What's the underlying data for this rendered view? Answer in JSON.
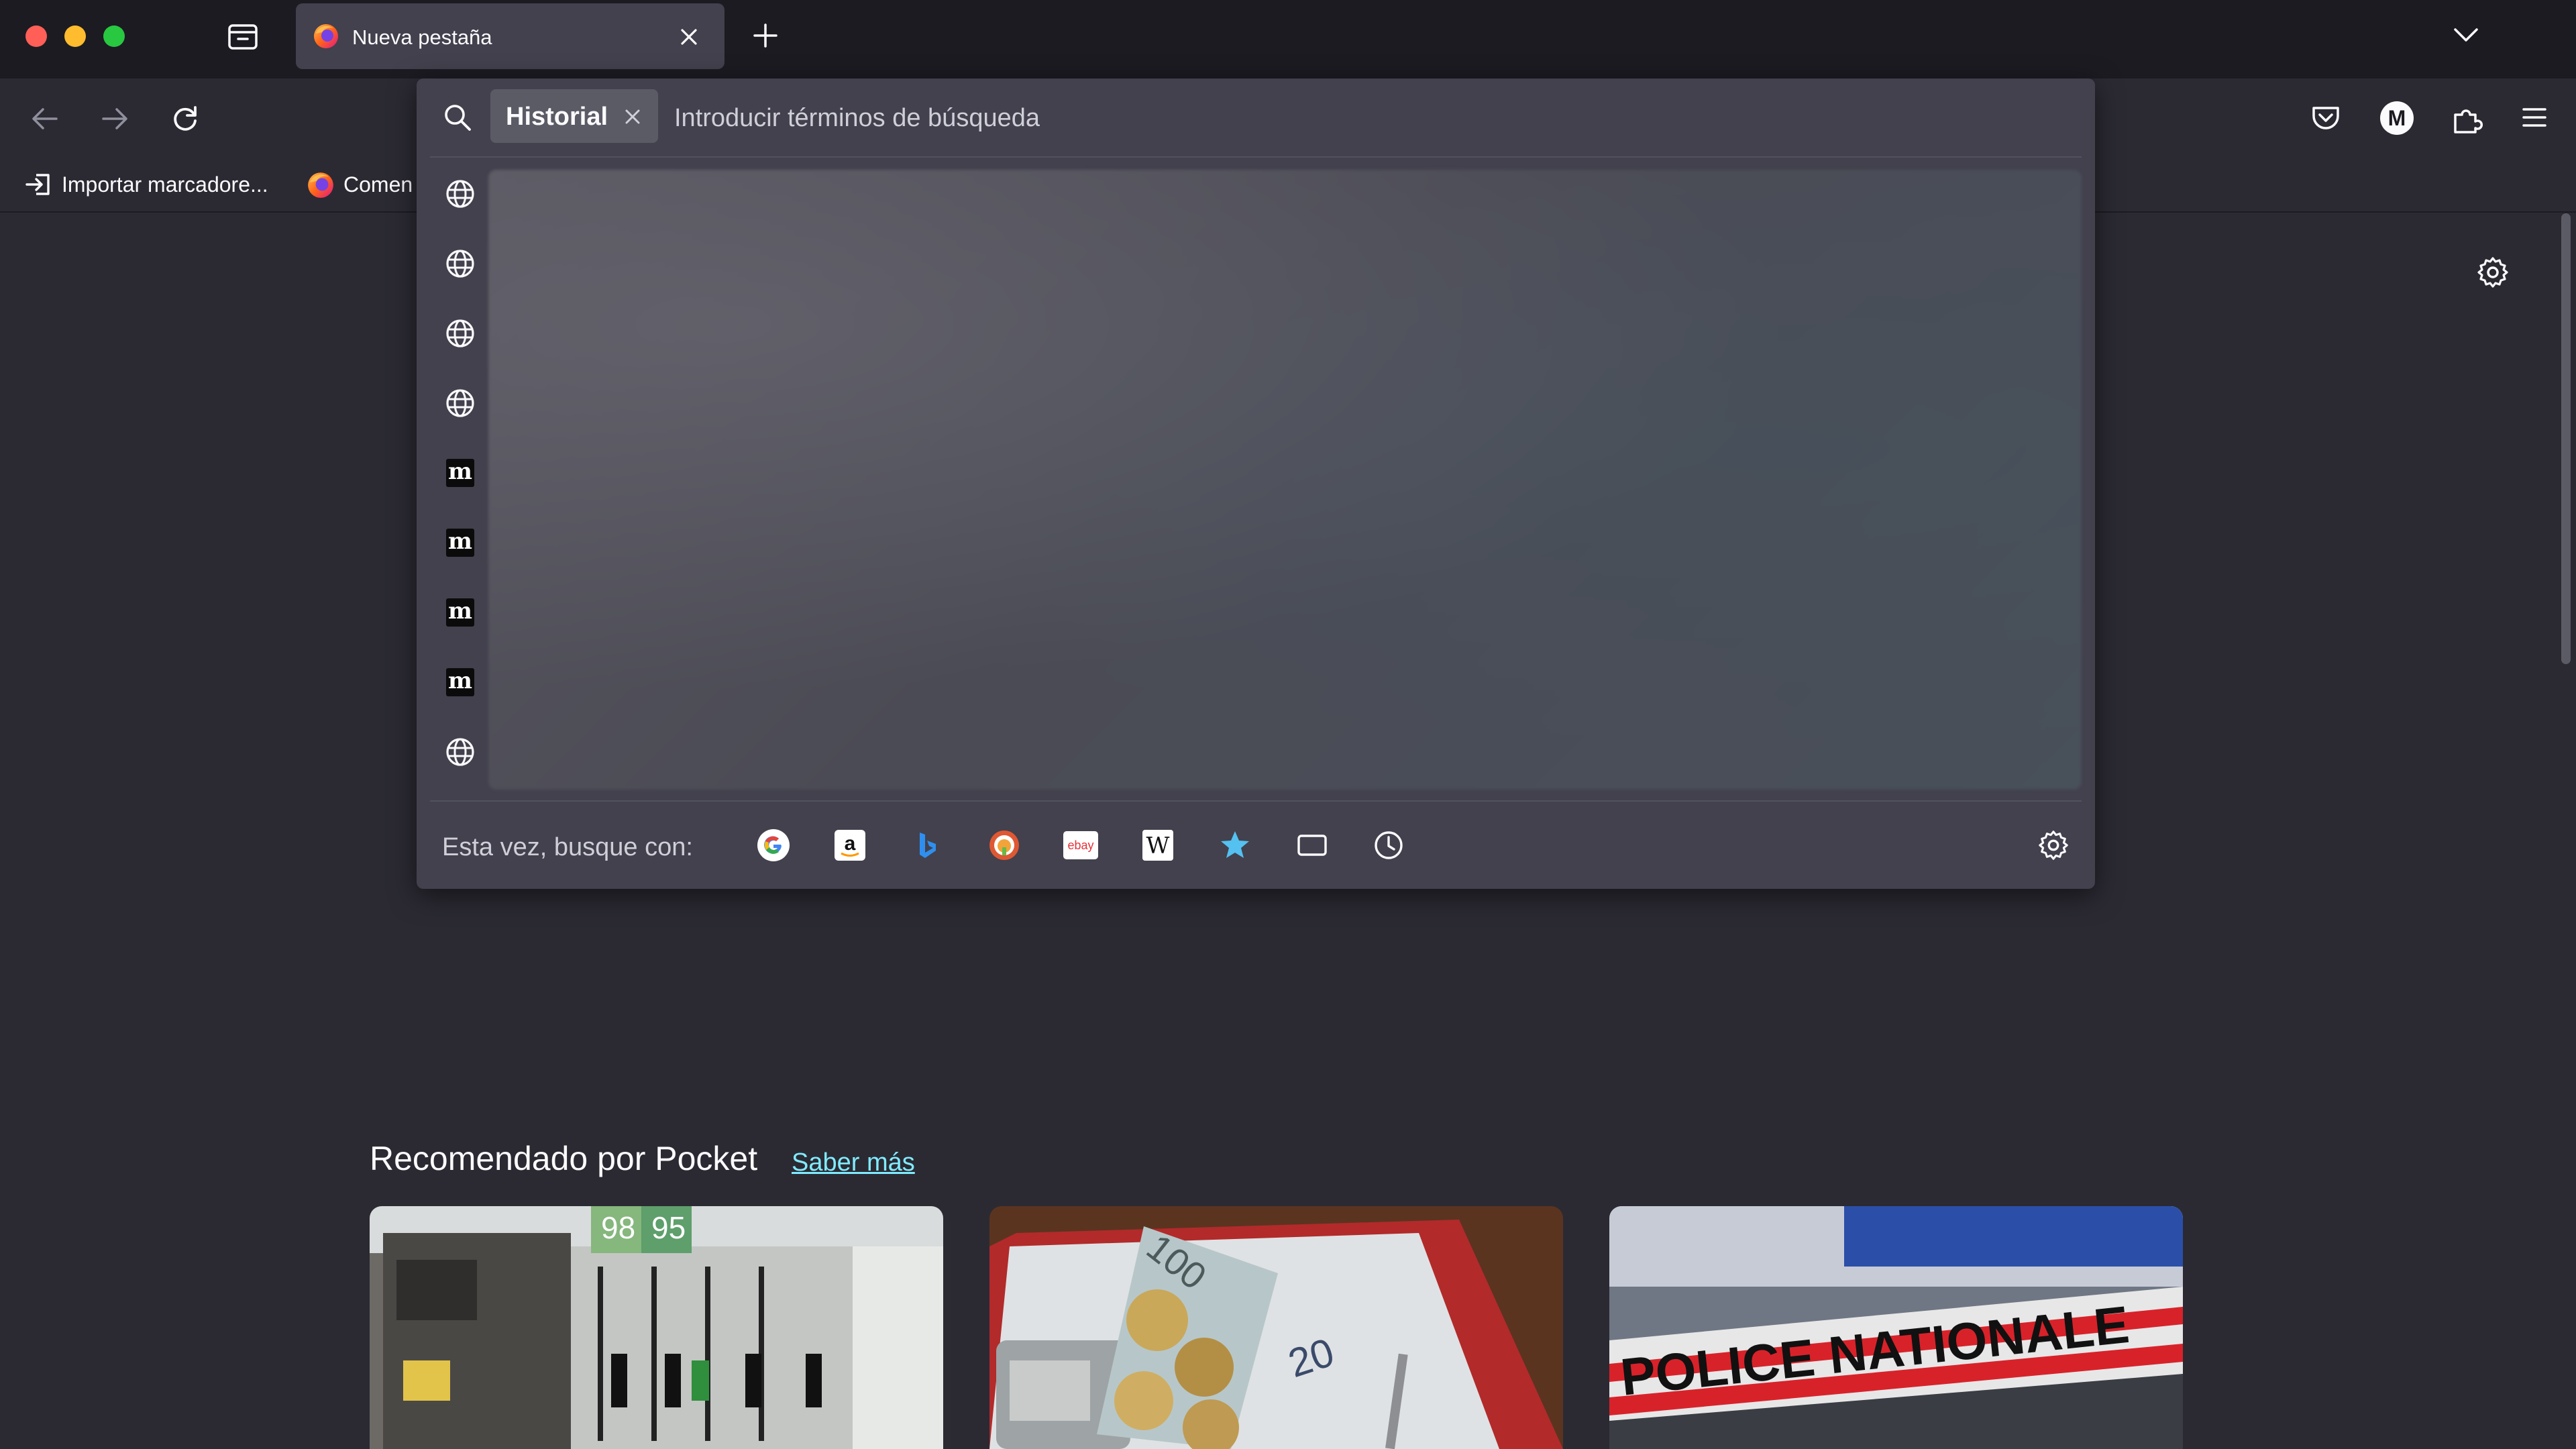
{
  "window": {
    "traffic_lights": {
      "close_color": "#ff5f57",
      "minimize_color": "#febc2e",
      "zoom_color": "#28c840"
    }
  },
  "tabs": [
    {
      "label": "Nueva pestaña",
      "active": true,
      "icon": "firefox-icon"
    }
  ],
  "toolbar": {
    "right_icons": [
      "pocket-icon",
      "account-avatar-icon",
      "extensions-icon",
      "menu-icon"
    ],
    "account_initial": "M"
  },
  "bookmarks": [
    {
      "label": "Importar marcadore...",
      "icon": "import-icon"
    },
    {
      "label": "Comen",
      "icon": "firefox-icon"
    }
  ],
  "urlbar": {
    "search_mode_chip": "Historial",
    "placeholder": "Introducir términos de búsqueda",
    "value": "",
    "result_icons": [
      "globe-icon",
      "globe-icon",
      "globe-icon",
      "globe-icon",
      "m-icon",
      "m-icon",
      "m-icon",
      "m-icon",
      "globe-icon"
    ],
    "result_m_glyph": "m",
    "one_off_label": "Esta vez, busque con:",
    "one_off_engines": [
      "google-icon",
      "amazon-icon",
      "bing-icon",
      "duckduckgo-icon",
      "ebay-icon",
      "wikipedia-icon",
      "bookmarks-star-icon",
      "tabs-icon",
      "history-clock-icon"
    ],
    "ebay_text": "ebay",
    "wikipedia_text": "W",
    "amazon_text": "a"
  },
  "pocket": {
    "title": "Recomendado por Pocket",
    "learn_more": "Saber más",
    "cards": [
      {
        "image": "fuel-pumps-photo",
        "overlay": [
          "98",
          "95"
        ]
      },
      {
        "image": "euro-banknotes-photo",
        "overlay": [
          "100",
          "20"
        ]
      },
      {
        "image": "police-tape-photo",
        "overlay": [
          "POLICE NATIONALE"
        ]
      }
    ]
  },
  "colors": {
    "tabstrip": "#1c1b22",
    "toolbar": "#2b2a33",
    "popup": "#42414d",
    "accent_link": "#80ebff",
    "text": "#fbfbfe"
  }
}
